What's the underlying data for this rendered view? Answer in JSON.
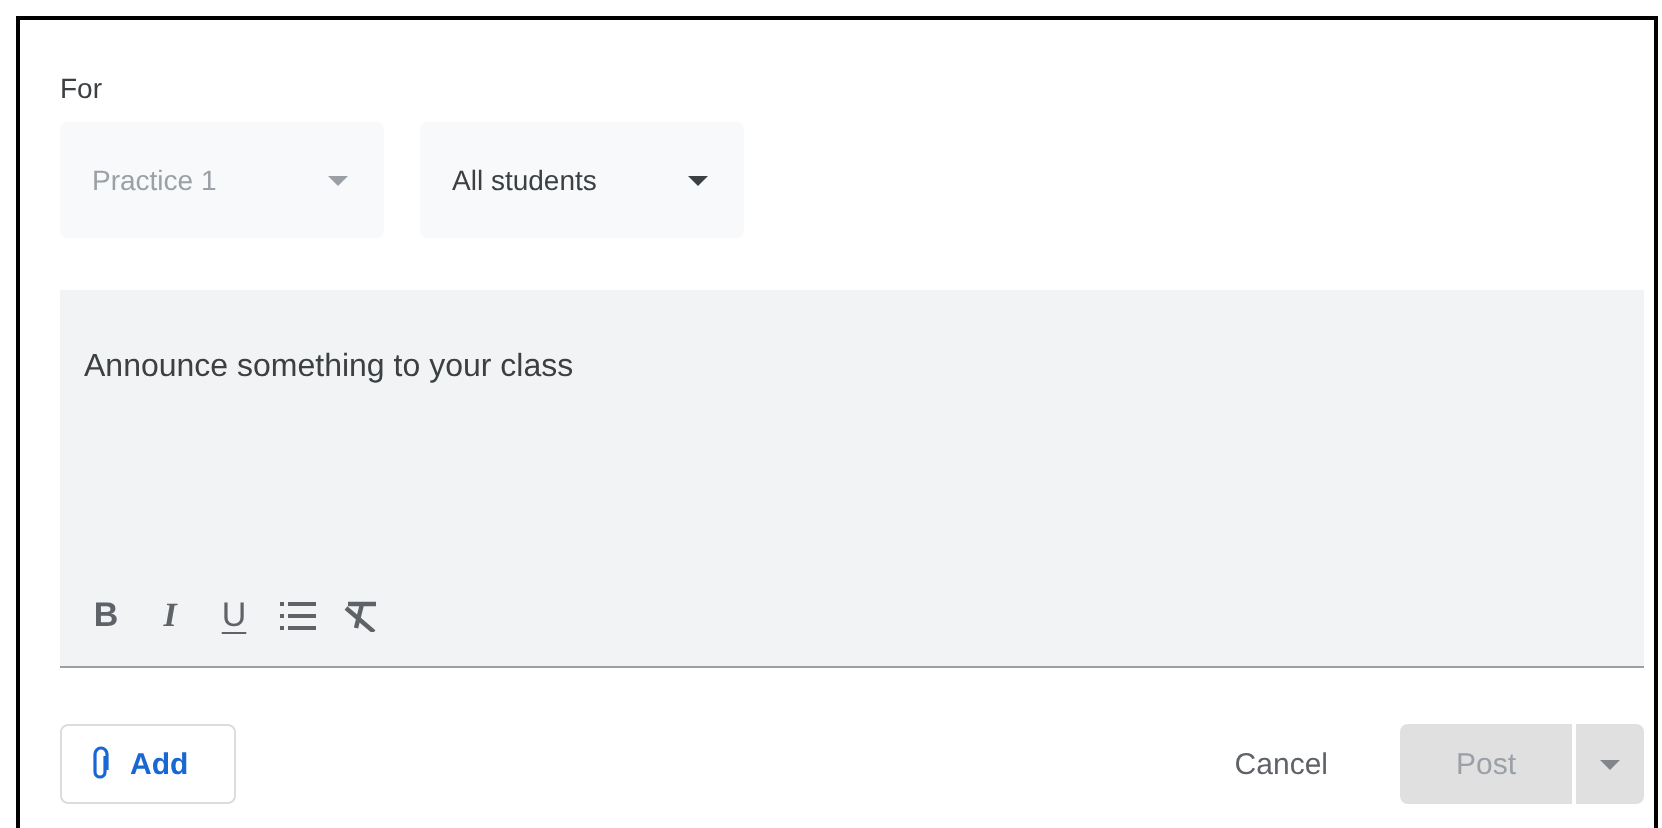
{
  "for_label": "For",
  "dropdowns": [
    {
      "label": "Practice 1",
      "disabled": true
    },
    {
      "label": "All students",
      "disabled": false
    }
  ],
  "announcement": {
    "placeholder": "Announce something to your class"
  },
  "format_toolbar": [
    {
      "kind": "bold",
      "label": "B"
    },
    {
      "kind": "italic",
      "label": "I"
    },
    {
      "kind": "underline",
      "label": "U"
    },
    {
      "kind": "list"
    },
    {
      "kind": "clear"
    }
  ],
  "add_button": {
    "label": "Add"
  },
  "cancel_button": {
    "label": "Cancel"
  },
  "post_button": {
    "label": "Post",
    "disabled": true
  }
}
